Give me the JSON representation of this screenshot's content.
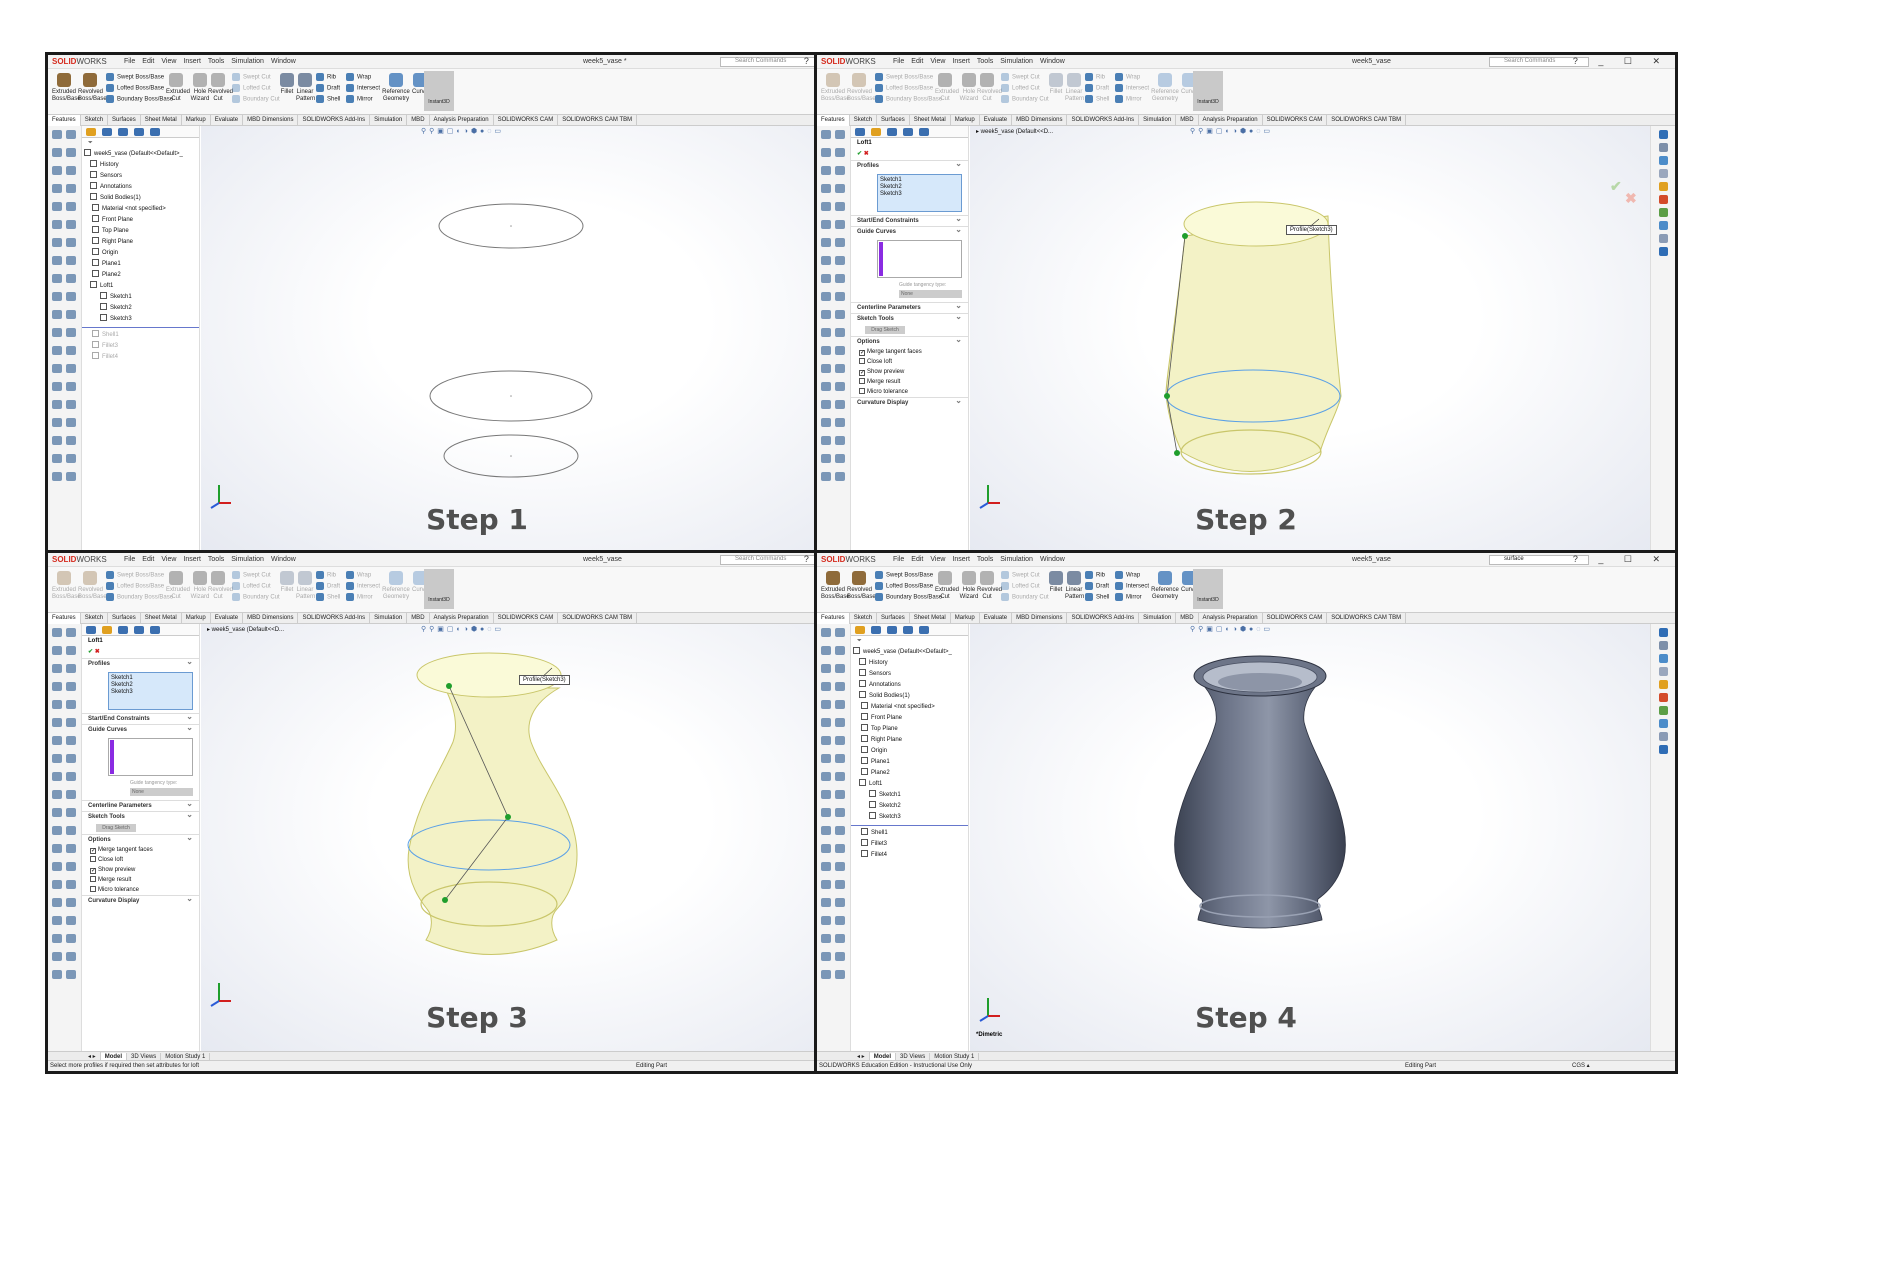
{
  "captions": [
    "Step 1",
    "Step 2",
    "Step 3",
    "Step 4"
  ],
  "app": {
    "logo_brand": "SOLID",
    "logo_rest": "WORKS",
    "menus": [
      "File",
      "Edit",
      "View",
      "Insert",
      "Tools",
      "Simulation",
      "Window"
    ],
    "search_placeholder": "Search Commands",
    "search_query_step4": "surface",
    "ribbon": {
      "extruded": "Extruded Boss/Base",
      "revolved": "Revolved Boss/Base",
      "swept_boss": "Swept Boss/Base",
      "lofted_boss": "Lofted Boss/Base",
      "boundary_boss": "Boundary Boss/Base",
      "extruded_cut": "Extruded Cut",
      "hole_wizard": "Hole Wizard",
      "revolved_cut": "Revolved Cut",
      "swept_cut": "Swept Cut",
      "lofted_cut": "Lofted Cut",
      "boundary_cut": "Boundary Cut",
      "fillet": "Fillet",
      "linear_pattern": "Linear Pattern",
      "rib": "Rib",
      "draft": "Draft",
      "shell": "Shell",
      "wrap": "Wrap",
      "intersect": "Intersect",
      "mirror": "Mirror",
      "reference_geometry": "Reference Geometry",
      "curves": "Curves",
      "instant3d": "Instant3D"
    },
    "command_tabs": [
      "Features",
      "Sketch",
      "Surfaces",
      "Sheet Metal",
      "Markup",
      "Evaluate",
      "MBD Dimensions",
      "SOLIDWORKS Add-Ins",
      "Simulation",
      "MBD",
      "Analysis Preparation",
      "SOLIDWORKS CAM",
      "SOLIDWORKS CAM TBM"
    ],
    "bottom_tabs": [
      "Model",
      "3D Views",
      "Motion Study 1"
    ]
  },
  "panels": [
    {
      "doc_title": "week5_vase *",
      "tree": [
        "week5_vase (Default<<Default>_",
        "History",
        "Sensors",
        "Annotations",
        "Solid Bodies(1)",
        "Material <not specified>",
        "Front Plane",
        "Top Plane",
        "Right Plane",
        "Origin",
        "Plane1",
        "Plane2",
        "Loft1",
        "Sketch1",
        "Sketch2",
        "Sketch3",
        "Shell1",
        "Fillet3",
        "Fillet4"
      ],
      "status_left": "SOLIDWORKS Education Edition - Instructional Use Only",
      "status_right": "",
      "units": "CGS"
    },
    {
      "doc_title": "week5_vase",
      "crumb": "week5_vase (Default<<D...",
      "status_left": "Select more profiles if required then set attributes for loft",
      "status_right": "Editing Part",
      "units": "CGS"
    },
    {
      "doc_title": "week5_vase",
      "crumb": "week5_vase (Default<<D...",
      "status_left": "Select more profiles if required then set attributes for loft",
      "status_right": "Editing Part",
      "units": ""
    },
    {
      "doc_title": "week5_vase",
      "tree": [
        "week5_vase (Default<<Default>_",
        "History",
        "Sensors",
        "Annotations",
        "Solid Bodies(1)",
        "Material <not specified>",
        "Front Plane",
        "Top Plane",
        "Right Plane",
        "Origin",
        "Plane1",
        "Plane2",
        "Loft1",
        "Sketch1",
        "Sketch2",
        "Sketch3",
        "Shell1",
        "Fillet3",
        "Fillet4"
      ],
      "view_label": "*Dimetric",
      "status_left": "SOLIDWORKS Education Edition - Instructional Use Only",
      "status_right": "Editing Part",
      "units": "CGS"
    }
  ],
  "loft_pm": {
    "title": "Loft1",
    "profiles_label": "Profiles",
    "profiles": [
      "Sketch1",
      "Sketch2",
      "Sketch3"
    ],
    "start_end": "Start/End Constraints",
    "guide_curves": "Guide Curves",
    "guide_tangency": "Guide tangency type:",
    "guide_tangency_value": "None",
    "centerline": "Centerline Parameters",
    "sketch_tools": "Sketch Tools",
    "drag_sketch": "Drag Sketch",
    "options": "Options",
    "opt_merge_tangent": "Merge tangent faces",
    "opt_close_loft": "Close loft",
    "opt_show_preview": "Show preview",
    "opt_merge_result": "Merge result",
    "opt_micro_tolerance": "Micro tolerance",
    "curvature": "Curvature Display",
    "callout": "Profile(Sketch3)"
  },
  "colors": {
    "loft_fill": "#f3f2c6",
    "loft_stroke": "#c9c66a",
    "section_blue": "#5aa0e6",
    "point_green": "#1f9e2c",
    "vase_dark": "#4a5163",
    "vase_light": "#9aa2b4"
  }
}
